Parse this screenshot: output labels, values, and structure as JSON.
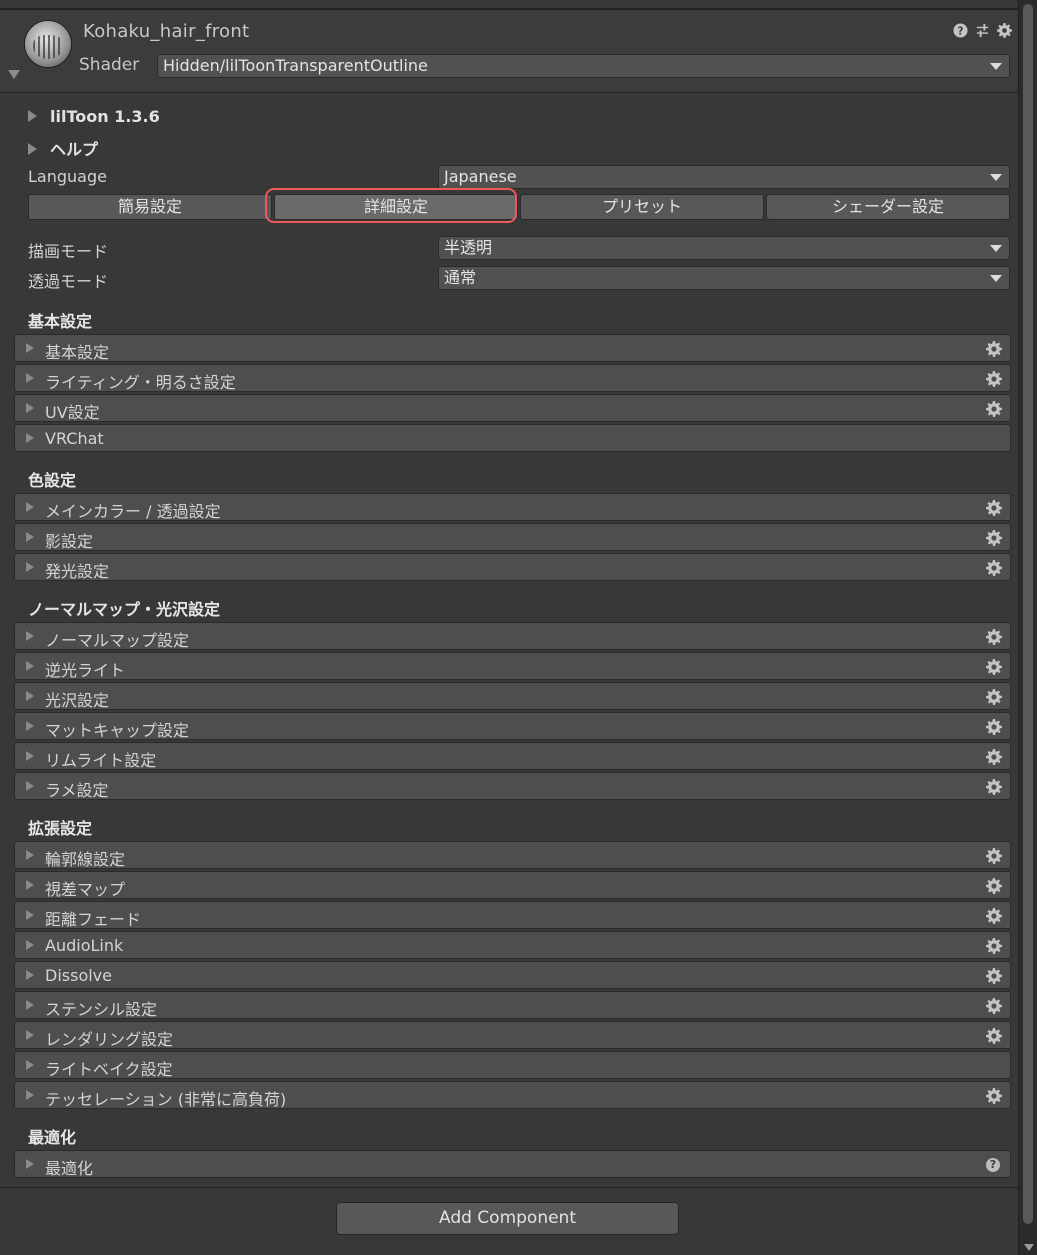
{
  "header": {
    "material_name": "Kohaku_hair_front",
    "shader_label": "Shader",
    "shader_value": "Hidden/lilToonTransparentOutline",
    "icons": [
      "help-icon",
      "preset-sliders-icon",
      "gear-icon"
    ]
  },
  "foldouts": [
    {
      "label": "lilToon 1.3.6"
    },
    {
      "label": "ヘルプ"
    }
  ],
  "language": {
    "label": "Language",
    "value": "Japanese"
  },
  "tabs": [
    {
      "label": "簡易設定"
    },
    {
      "label": "詳細設定"
    },
    {
      "label": "プリセット"
    },
    {
      "label": "シェーダー設定"
    }
  ],
  "active_tab": "詳細設定",
  "highlight_color": "#f0595c",
  "render_mode": {
    "label": "描画モード",
    "value": "半透明"
  },
  "transparent_mode": {
    "label": "透過モード",
    "value": "通常"
  },
  "sections": [
    {
      "title": "基本設定",
      "items": [
        {
          "label": "基本設定",
          "gear": true
        },
        {
          "label": "ライティング・明るさ設定",
          "gear": true
        },
        {
          "label": "UV設定",
          "gear": true
        },
        {
          "label": "VRChat",
          "gear": false
        }
      ]
    },
    {
      "title": "色設定",
      "items": [
        {
          "label": "メインカラー / 透過設定",
          "gear": true
        },
        {
          "label": "影設定",
          "gear": true
        },
        {
          "label": "発光設定",
          "gear": true
        }
      ]
    },
    {
      "title": "ノーマルマップ・光沢設定",
      "items": [
        {
          "label": "ノーマルマップ設定",
          "gear": true
        },
        {
          "label": "逆光ライト",
          "gear": true
        },
        {
          "label": "光沢設定",
          "gear": true
        },
        {
          "label": "マットキャップ設定",
          "gear": true
        },
        {
          "label": "リムライト設定",
          "gear": true
        },
        {
          "label": "ラメ設定",
          "gear": true
        }
      ]
    },
    {
      "title": "拡張設定",
      "items": [
        {
          "label": "輪郭線設定",
          "gear": true
        },
        {
          "label": "視差マップ",
          "gear": true
        },
        {
          "label": "距離フェード",
          "gear": true
        },
        {
          "label": "AudioLink",
          "gear": true
        },
        {
          "label": "Dissolve",
          "gear": true
        },
        {
          "label": "ステンシル設定",
          "gear": true
        },
        {
          "label": "レンダリング設定",
          "gear": true
        },
        {
          "label": "ライトベイク設定",
          "gear": false
        },
        {
          "label": "テッセレーション (非常に高負荷)",
          "gear": true
        }
      ]
    },
    {
      "title": "最適化",
      "items": [
        {
          "label": "最適化",
          "gear": false,
          "help": true
        }
      ]
    }
  ],
  "add_component_label": "Add Component"
}
